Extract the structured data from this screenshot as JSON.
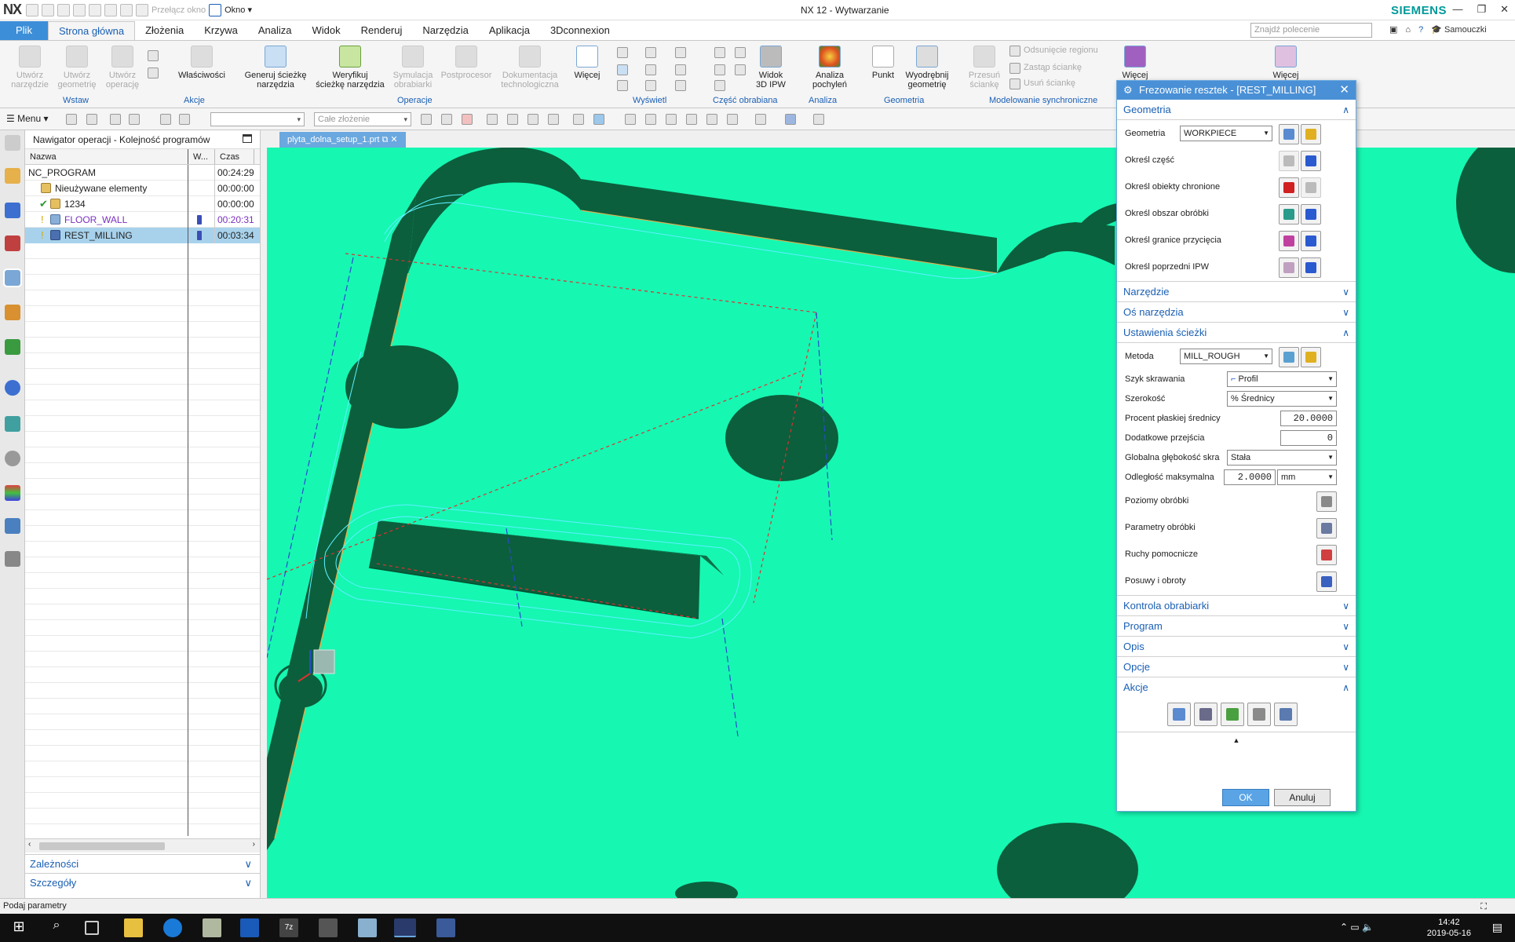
{
  "app": {
    "logo": "NX",
    "title": "NX 12 - Wytwarzanie",
    "brand": "SIEMENS",
    "qat_switch_window": "Przełącz okno",
    "qat_window": "Okno"
  },
  "tabs": [
    {
      "label": "Plik"
    },
    {
      "label": "Strona główna"
    },
    {
      "label": "Złożenia"
    },
    {
      "label": "Krzywa"
    },
    {
      "label": "Analiza"
    },
    {
      "label": "Widok"
    },
    {
      "label": "Renderuj"
    },
    {
      "label": "Narzędzia"
    },
    {
      "label": "Aplikacja"
    },
    {
      "label": "3Dconnexion"
    }
  ],
  "search": {
    "placeholder": "Znajdź polecenie"
  },
  "user": "Samouczki",
  "ribbon": {
    "create_tool": "Utwórz\nnarzędzie",
    "create_geometry": "Utwórz\ngeometrię",
    "create_operation": "Utwórz\noperację",
    "group_insert": "Wstaw",
    "properties": "Właściwości",
    "group_actions": "Akcje",
    "generate_path": "Generuj ścieżkę\nnarzędzia",
    "verify_path": "Weryfikuj\nścieżkę narzędzia",
    "simulate": "Symulacja\nobrabiarki",
    "postprocessor": "Postprocesor",
    "documentation": "Dokumentacja\ntechnologiczna",
    "more1": "Więcej",
    "group_operations": "Operacje",
    "group_display": "Wyświetl",
    "view_ipw": "Widok\n3D IPW",
    "group_machining_part": "Część obrabiana",
    "draft_analysis": "Analiza\npochyleń",
    "group_analysis": "Analiza",
    "point": "Punkt",
    "extract_geometry": "Wyodrębnij\ngeometrię",
    "group_geometry": "Geometria",
    "move_face": "Przesuń\nściankę",
    "offset_region": "Odsunięcie regionu",
    "replace_face": "Zastąp ściankę",
    "delete_face": "Usuń ściankę",
    "group_sync": "Modelowanie synchroniczne",
    "more2": "Więcej",
    "more3": "Więcej"
  },
  "toolbar2": {
    "menu": "Menu",
    "assembly_combo": "Całe złożenie"
  },
  "navigator": {
    "title": "Nawigator operacji - Kolejność programów",
    "columns": [
      "Nazwa",
      "W...",
      "Czas"
    ],
    "rows": [
      {
        "name": "NC_PROGRAM",
        "time": "00:24:29",
        "indent": 0
      },
      {
        "name": "Nieużywane elementy",
        "time": "00:00:00",
        "indent": 1
      },
      {
        "name": "1234",
        "time": "00:00:00",
        "indent": 1
      },
      {
        "name": "FLOOR_WALL",
        "time": "00:20:31",
        "indent": 2
      },
      {
        "name": "REST_MILLING",
        "time": "00:03:34",
        "indent": 2
      }
    ],
    "sections": [
      "Zależności",
      "Szczegóły"
    ]
  },
  "graphics": {
    "file_tab": "plyta_dolna_setup_1.prt"
  },
  "dialog": {
    "title": "Frezowanie resztek - [REST_MILLING]",
    "sec_geometry": "Geometria",
    "geometry_label": "Geometria",
    "geometry_value": "WORKPIECE",
    "specify_part": "Określ część",
    "specify_check": "Określ obiekty chronione",
    "specify_cut_area": "Określ obszar obróbki",
    "specify_trim": "Określ granice przycięcia",
    "specify_ipw": "Określ poprzedni IPW",
    "sec_tool": "Narzędzie",
    "sec_tool_axis": "Oś narzędzia",
    "sec_path_settings": "Ustawienia ścieżki",
    "method_label": "Metoda",
    "method_value": "MILL_ROUGH",
    "cut_pattern_label": "Szyk skrawania",
    "cut_pattern_value": "Profil",
    "stepover_label": "Szerokość",
    "stepover_value": "% Średnicy",
    "percent_flat_label": "Procent płaskiej średnicy",
    "percent_flat_value": "20.0000",
    "additional_passes_label": "Dodatkowe przejścia",
    "additional_passes_value": "0",
    "common_depth_label": "Globalna głębokość skra",
    "common_depth_value": "Stała",
    "max_distance_label": "Odległość maksymalna",
    "max_distance_value": "2.0000",
    "max_distance_unit": "mm",
    "cut_levels": "Poziomy obróbki",
    "cutting_params": "Parametry obróbki",
    "non_cutting": "Ruchy pomocnicze",
    "feeds_speeds": "Posuwy i obroty",
    "sec_machine_control": "Kontrola obrabiarki",
    "sec_program": "Program",
    "sec_description": "Opis",
    "sec_options": "Opcje",
    "sec_actions": "Akcje",
    "ok": "OK",
    "cancel": "Anuluj"
  },
  "status": "Podaj parametry",
  "clock": {
    "time": "14:42",
    "date": "2019-05-16"
  },
  "colors": {
    "viewport_bg": "#16f7b2",
    "part_dark": "#0b5f3c",
    "accent": "#4a90d6"
  }
}
